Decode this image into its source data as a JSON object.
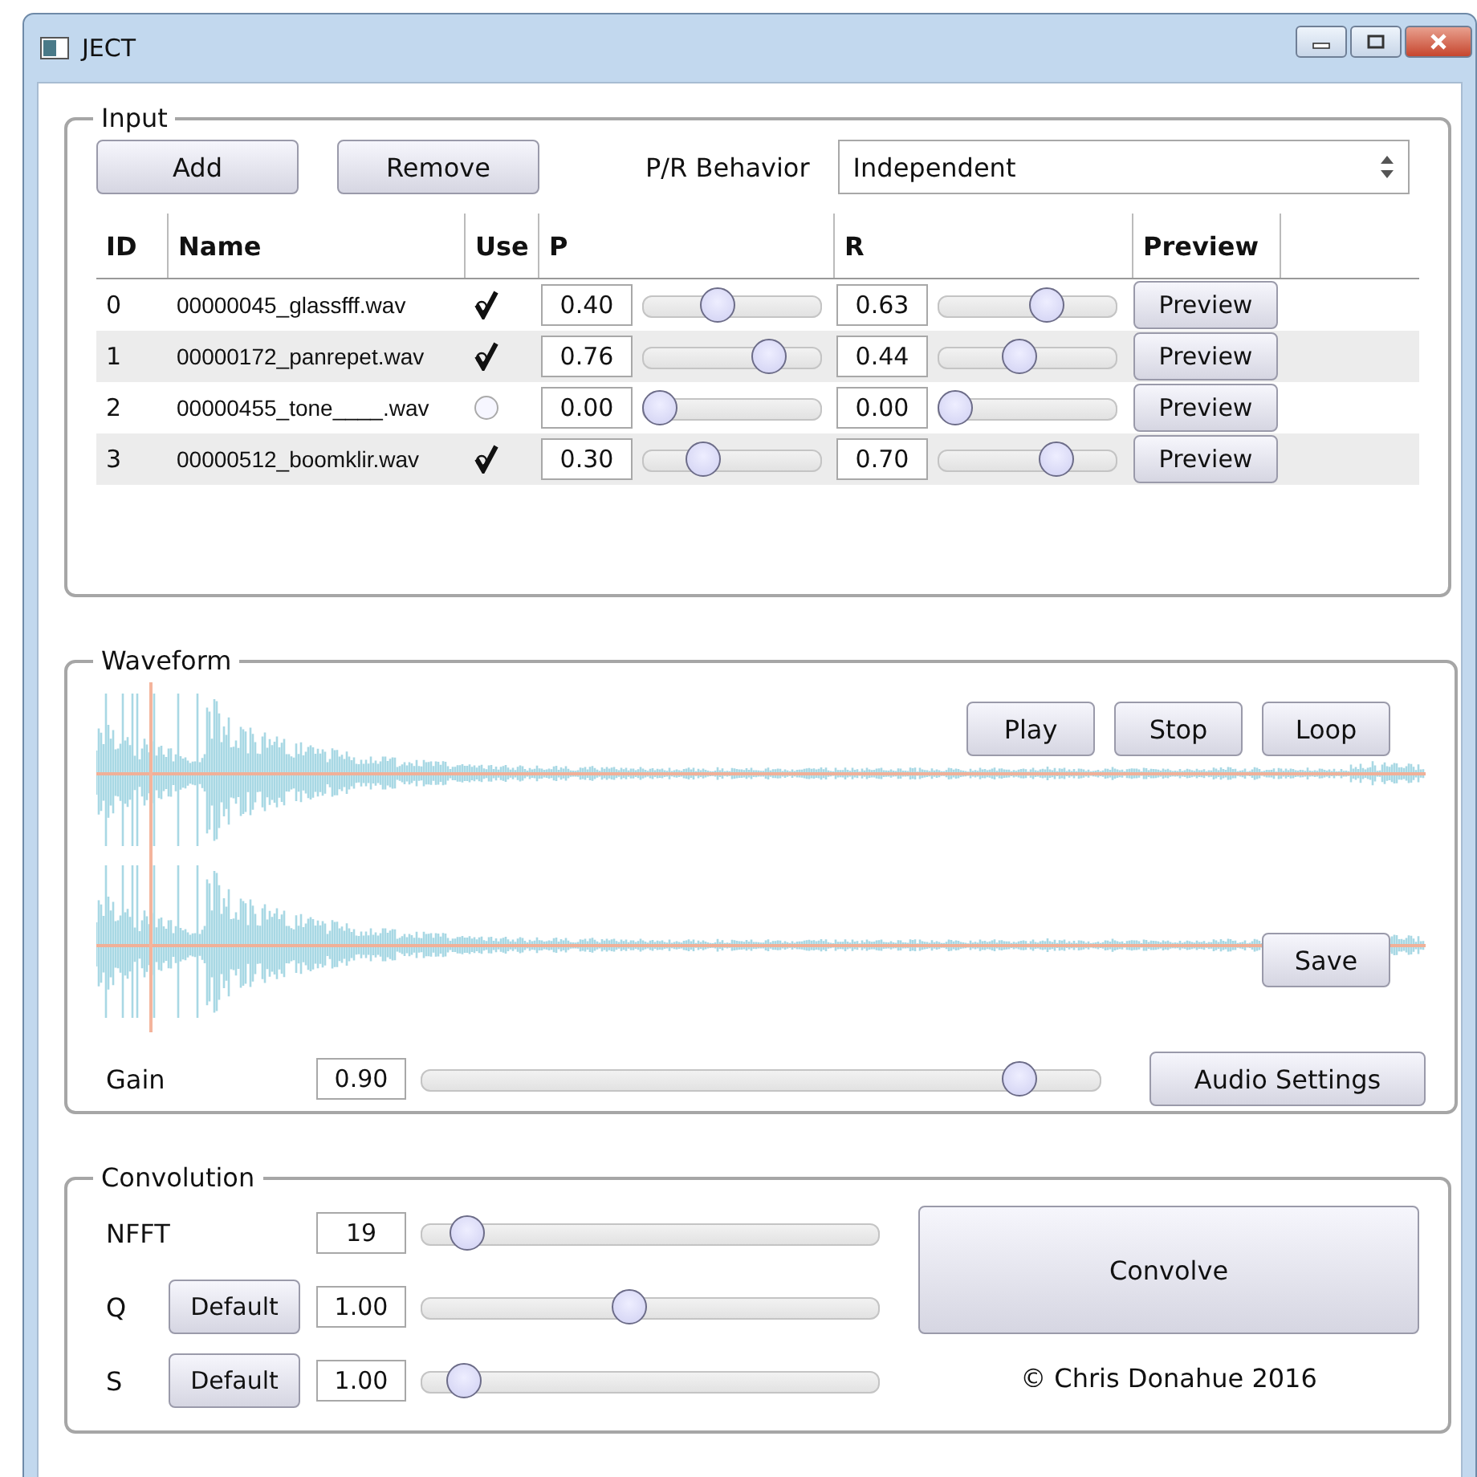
{
  "window": {
    "title": "JECT"
  },
  "input": {
    "title": "Input",
    "buttons": [
      "Add",
      "Remove"
    ],
    "behavior_label": "P/R Behavior",
    "behavior": "Independent",
    "columns": [
      "ID",
      "Name",
      "Use",
      "P",
      "R",
      "Preview"
    ],
    "rows": [
      {
        "id": "0",
        "name": "00000045_glassfff.wav",
        "use": true,
        "p": {
          "value": "0.40",
          "level": 0.4
        },
        "r": {
          "value": "0.63",
          "level": 0.63
        },
        "preview": "Preview"
      },
      {
        "id": "1",
        "name": "00000172_panrepet.wav",
        "use": true,
        "p": {
          "value": "0.76",
          "level": 0.76
        },
        "r": {
          "value": "0.44",
          "level": 0.44
        },
        "preview": "Preview"
      },
      {
        "id": "2",
        "name": "00000455_tone____.wav",
        "use": false,
        "p": {
          "value": "0.00",
          "level": 0
        },
        "r": {
          "value": "0.00",
          "level": 0
        },
        "preview": "Preview"
      },
      {
        "id": "3",
        "name": "00000512_boomklir.wav",
        "use": true,
        "p": {
          "value": "0.30",
          "level": 0.3
        },
        "r": {
          "value": "0.70",
          "level": 0.7
        },
        "preview": "Preview"
      }
    ]
  },
  "waveform": {
    "title": "Waveform",
    "buttons": [
      "Play",
      "Stop",
      "Loop"
    ],
    "save": "Save",
    "gain": {
      "label": "Gain",
      "value": "0.90",
      "level": 0.9
    },
    "settings": "Audio Settings"
  },
  "convolution": {
    "title": "Convolution",
    "params": [
      {
        "label": "NFFT",
        "value": "19",
        "level": 0.07
      },
      {
        "label": "Q",
        "default": "Default",
        "value": "1.00",
        "level": 0.45
      },
      {
        "label": "S",
        "default": "Default",
        "value": "1.00",
        "level": 0.06
      }
    ],
    "convolve": "Convolve",
    "credit": "© Chris Donahue 2016"
  }
}
